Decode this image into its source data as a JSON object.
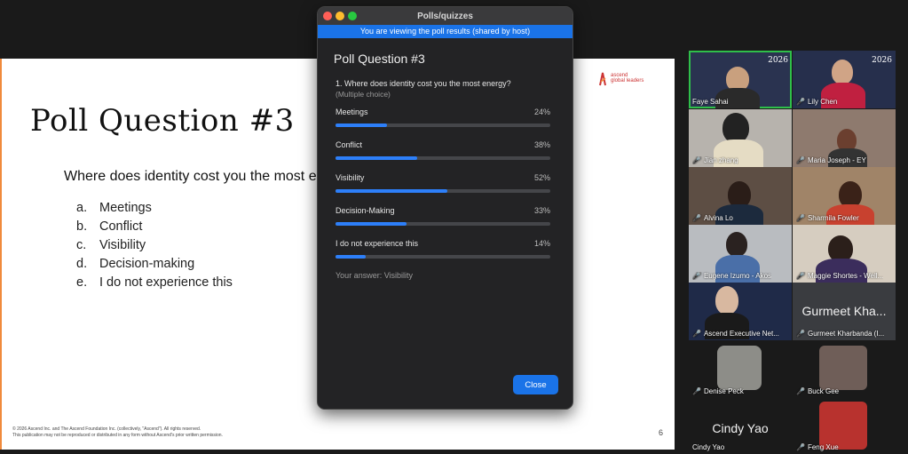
{
  "slide": {
    "title": "Poll Question #3",
    "question": "Where does identity cost you the most energy?",
    "options": [
      {
        "letter": "a.",
        "text": "Meetings"
      },
      {
        "letter": "b.",
        "text": "Conflict"
      },
      {
        "letter": "c.",
        "text": "Visibility"
      },
      {
        "letter": "d.",
        "text": "Decision-making"
      },
      {
        "letter": "e.",
        "text": "I do not experience this"
      }
    ],
    "logo_line1": "ascend",
    "logo_line2": "global leaders",
    "footer_line1": "© 2026 Ascend Inc. and The Ascend Foundation Inc. (collectively, \"Ascend\").  All rights reserved.",
    "footer_line2": "This publication may not be reproduced or distributed in any form without Ascend's prior written permission.",
    "page_number": "6",
    "colors": {
      "accent": "#f08a3c",
      "logo": "#cc3333"
    }
  },
  "poll": {
    "window_title": "Polls/quizzes",
    "banner": "You are viewing the poll results (shared by host)",
    "heading": "Poll Question #3",
    "question": "1. Where does identity cost you the most energy?",
    "question_type": "(Multiple choice)",
    "results": [
      {
        "label": "Meetings",
        "percent_text": "24%",
        "fraction": 0.24
      },
      {
        "label": "Conflict",
        "percent_text": "38%",
        "fraction": 0.38
      },
      {
        "label": "Visibility",
        "percent_text": "52%",
        "fraction": 0.52
      },
      {
        "label": "Decision-Making",
        "percent_text": "33%",
        "fraction": 0.33
      },
      {
        "label": "I do not experience this",
        "percent_text": "14%",
        "fraction": 0.14
      }
    ],
    "your_answer": "Your answer: Visibility",
    "close_label": "Close",
    "colors": {
      "bar": "#2d7ff9",
      "banner": "#1a73e8",
      "close": "#1a73e8",
      "traffic_red": "#ff5f57",
      "traffic_yellow": "#febc2e",
      "traffic_green": "#28c840"
    }
  },
  "gallery": [
    {
      "name": "Faye Sahai",
      "muted": false,
      "active": true,
      "big_name": "",
      "banner_text": "2026"
    },
    {
      "name": "Lily Chen",
      "muted": true,
      "active": false,
      "big_name": "",
      "banner_text": "2026"
    },
    {
      "name": "Jian zhang",
      "muted": true,
      "active": false,
      "big_name": "",
      "banner_text": ""
    },
    {
      "name": "Maria Joseph - EY",
      "muted": true,
      "active": false,
      "big_name": "",
      "banner_text": ""
    },
    {
      "name": "Alvina Lo",
      "muted": true,
      "active": false,
      "big_name": "",
      "banner_text": ""
    },
    {
      "name": "Sharmila Fowler",
      "muted": true,
      "active": false,
      "big_name": "",
      "banner_text": ""
    },
    {
      "name": "Eugene Izumo - Akos",
      "muted": true,
      "active": false,
      "big_name": "",
      "banner_text": ""
    },
    {
      "name": "Maggie Shortes - Well...",
      "muted": true,
      "active": false,
      "big_name": "",
      "banner_text": ""
    },
    {
      "name": "Ascend Executive Net...",
      "muted": true,
      "active": false,
      "big_name": "",
      "banner_text": ""
    },
    {
      "name": "Gurmeet Kharbanda (I...",
      "muted": true,
      "active": false,
      "big_name": "Gurmeet Kha...",
      "banner_text": ""
    },
    {
      "name": "Denise Peck",
      "muted": true,
      "active": false,
      "big_name": "",
      "banner_text": ""
    },
    {
      "name": "Buck Gee",
      "muted": true,
      "active": false,
      "big_name": "",
      "banner_text": ""
    },
    {
      "name": "Cindy Yao",
      "muted": false,
      "active": false,
      "big_name": "Cindy Yao",
      "banner_text": ""
    },
    {
      "name": "Feng Xue",
      "muted": true,
      "active": false,
      "big_name": "",
      "banner_text": ""
    }
  ]
}
